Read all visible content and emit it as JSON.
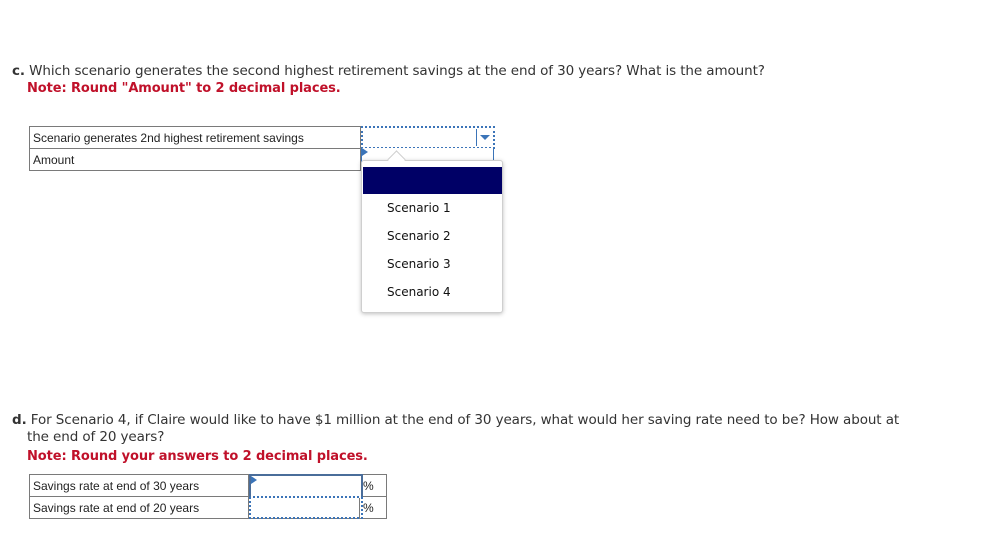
{
  "part_c": {
    "letter": "c.",
    "question": "Which scenario generates the second highest retirement savings at the end of 30 years? What is the amount?",
    "note": "Note: Round \"Amount\" to 2 decimal places.",
    "rows": [
      {
        "label": "Scenario generates 2nd highest retirement savings",
        "value": "",
        "type": "select"
      },
      {
        "label": "Amount",
        "value": "",
        "type": "input"
      }
    ],
    "dropdown": {
      "open": true,
      "highlighted": "",
      "options": [
        "Scenario 1",
        "Scenario 2",
        "Scenario 3",
        "Scenario 4"
      ]
    }
  },
  "part_d": {
    "letter": "d.",
    "question_line1": "For Scenario 4, if Claire would like to have $1 million at the end of 30 years, what would her saving rate need to be? How about at",
    "question_line2": "the end of 20 years?",
    "note": "Note: Round your answers to 2 decimal places.",
    "rows": [
      {
        "label": "Savings rate at end of 30 years",
        "value": "",
        "unit": "%"
      },
      {
        "label": "Savings rate at end of 20 years",
        "value": "",
        "unit": "%"
      }
    ]
  },
  "colors": {
    "note_red": "#c0112a",
    "focus_blue": "#3b74b8",
    "highlight_navy": "#000066"
  }
}
